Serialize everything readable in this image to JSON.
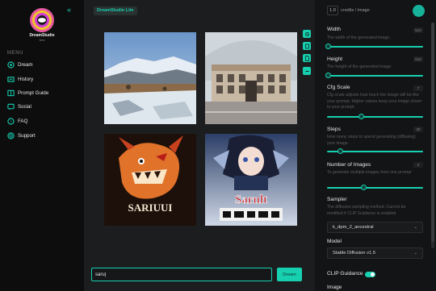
{
  "sidebar": {
    "brand": "DreamStudio",
    "brand_sub": "beta",
    "menu_label": "MENU",
    "items": [
      {
        "label": "Dream",
        "icon": "dream-icon"
      },
      {
        "label": "History",
        "icon": "history-icon"
      },
      {
        "label": "Prompt Guide",
        "icon": "prompt-guide-icon"
      },
      {
        "label": "Social",
        "icon": "social-icon"
      },
      {
        "label": "FAQ",
        "icon": "faq-icon"
      },
      {
        "label": "Support",
        "icon": "support-icon"
      }
    ]
  },
  "header": {
    "app_tag": "DreamStudio Lite",
    "credits_value": "1.0",
    "credits_label": "credits / image"
  },
  "gallery": {
    "images": [
      {
        "caption": "",
        "icon": "snowy-mountain-image"
      },
      {
        "caption": "",
        "icon": "building-image"
      },
      {
        "caption": "SARIUUI",
        "icon": "dragon-character-image"
      },
      {
        "caption": "Sarnlt",
        "icon": "anime-girl-poster-image"
      }
    ]
  },
  "prompt": {
    "value": "saru|",
    "dream_label": "Dream"
  },
  "settings": {
    "width": {
      "title": "Width",
      "desc": "The width of the generated image.",
      "value": "512",
      "level": 0.0
    },
    "height": {
      "title": "Height",
      "desc": "The height of the generated image.",
      "value": "512",
      "level": 0.0
    },
    "cfg": {
      "title": "Cfg Scale",
      "desc": "Cfg scale adjusts how much the image will be like your prompt. Higher values keep your image closer to your prompt.",
      "value": "7",
      "level": 0.35
    },
    "steps": {
      "title": "Steps",
      "desc": "How many steps to spend generating (diffusing) your image.",
      "value": "30",
      "level": 0.12
    },
    "num_images": {
      "title": "Number of Images",
      "desc": "To generate multiple images from one prompt",
      "value": "4",
      "level": 0.38
    },
    "sampler": {
      "title": "Sampler",
      "desc": "The diffusion sampling method. Cannot be modified if CLIP Guidance is enabled",
      "value": "k_dpm_2_ancestral"
    },
    "model": {
      "title": "Model",
      "value": "Stable Diffusion v1.5"
    },
    "clip": {
      "title": "CLIP Guidance",
      "enabled": true
    },
    "image": {
      "title": "Image"
    }
  },
  "colors": {
    "accent": "#17d0b0",
    "sidebar_bg": "#0d0d0e",
    "panel_bg": "#131415"
  }
}
